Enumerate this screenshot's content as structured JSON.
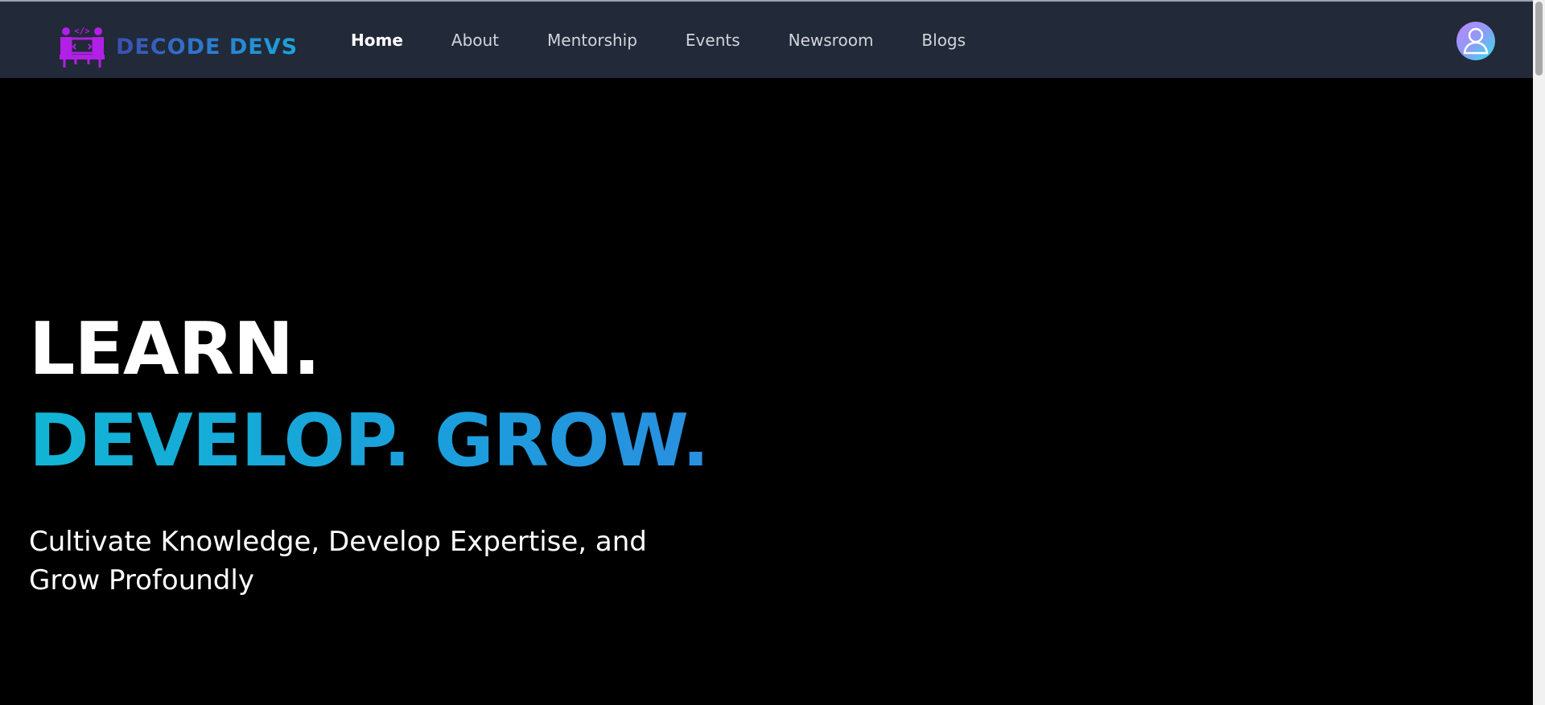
{
  "brand": {
    "name": "DECODE DEVS",
    "logo_icon": "two-developers-laptop-icon",
    "code_glyph": "</>",
    "colors": {
      "logo_purple": "#b21fe6",
      "logo_text_start": "#3b4fb0",
      "logo_text_end": "#1aa6d9"
    }
  },
  "navbar": {
    "background": "#222938",
    "links": [
      {
        "label": "Home",
        "active": true
      },
      {
        "label": "About",
        "active": false
      },
      {
        "label": "Mentorship",
        "active": false
      },
      {
        "label": "Events",
        "active": false
      },
      {
        "label": "Newsroom",
        "active": false
      },
      {
        "label": "Blogs",
        "active": false
      }
    ],
    "avatar_icon": "user-avatar-icon"
  },
  "hero": {
    "line1": "LEARN.",
    "line2": "DEVELOP. GROW.",
    "subtitle": "Cultivate Knowledge, Develop Expertise, and Grow Profoundly",
    "colors": {
      "line1": "#ffffff",
      "line2": "#17a7d9",
      "background": "#000000"
    }
  }
}
